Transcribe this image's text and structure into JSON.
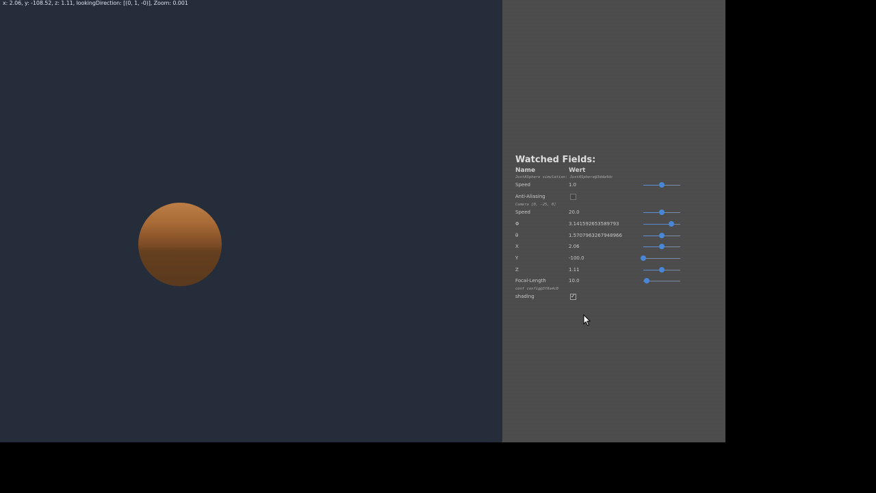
{
  "status_line": "x: 2.06, y: -108.52, z: 1.11, lookingDirection: [(0, 1, -0)],  Zoom: 0.001",
  "panel": {
    "title": "Watched Fields:",
    "col_name": "Name",
    "col_value": "Wert",
    "note_object": "JustASphere simulation: JustASphere@3dda4dc",
    "note_camera": "Camera [0, -25, 0]",
    "note_conf": "conf config@3f8a4c0",
    "rows": {
      "speed_sim": {
        "label": "Speed",
        "value": "1.0",
        "level": 0.5
      },
      "anti_aliasing": {
        "label": "Anti-Aliasing",
        "checked": false
      },
      "speed_cam": {
        "label": "Speed",
        "value": "20.0",
        "level": 0.5
      },
      "phi": {
        "label": "Φ",
        "value": "3.141592653589793",
        "level": 0.75
      },
      "theta": {
        "label": "θ",
        "value": "1.5707963267948966",
        "level": 0.5
      },
      "x": {
        "label": "X",
        "value": "2.06",
        "level": 0.5
      },
      "y": {
        "label": "Y",
        "value": "-100.0",
        "level": 0.0
      },
      "z": {
        "label": "Z",
        "value": "1.11",
        "level": 0.5
      },
      "focal": {
        "label": "Focal-Length",
        "value": "10.0",
        "level": 0.1
      },
      "shading": {
        "label": "shading",
        "checked": true
      }
    }
  }
}
